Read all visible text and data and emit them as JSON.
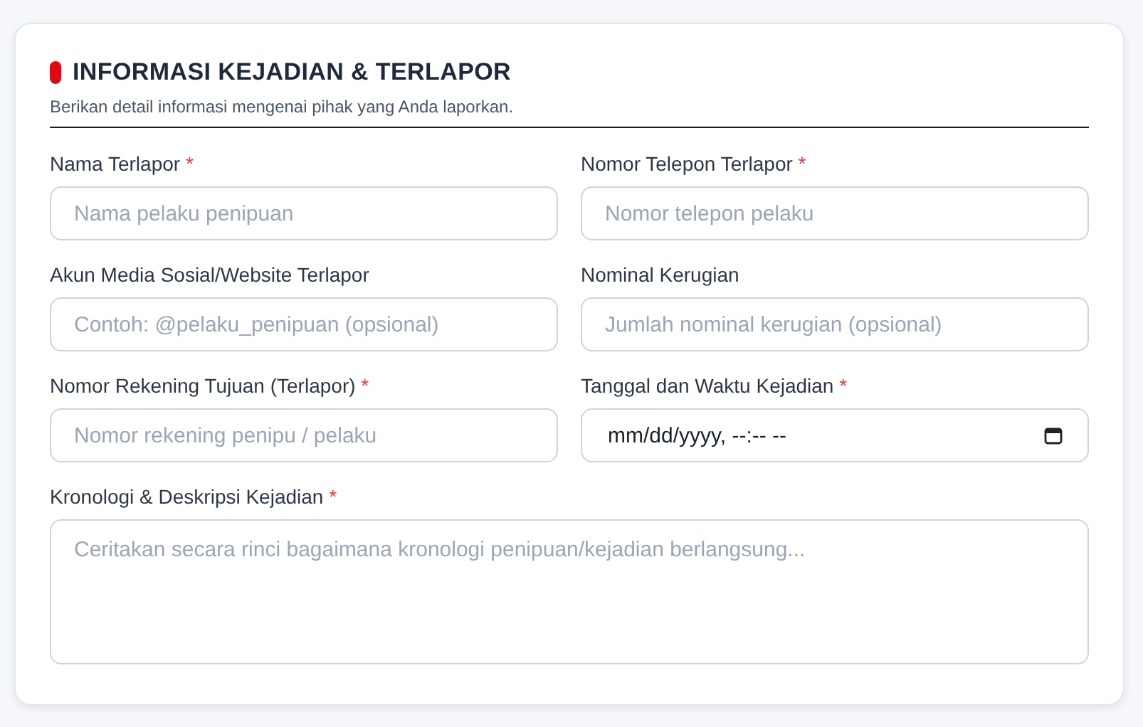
{
  "section": {
    "title": "INFORMASI KEJADIAN & TERLAPOR",
    "subtitle": "Berikan detail informasi mengenai pihak yang Anda laporkan."
  },
  "fields": [
    {
      "kind": "text",
      "label": "Nama Terlapor",
      "required_mark": "*",
      "placeholder": "Nama pelaku penipuan"
    },
    {
      "kind": "text",
      "label": "Nomor Telepon Terlapor",
      "required_mark": "*",
      "placeholder": "Nomor telepon pelaku"
    },
    {
      "kind": "text",
      "label": "Akun Media Sosial/Website Terlapor",
      "placeholder": "Contoh: @pelaku_penipuan (opsional)"
    },
    {
      "kind": "text",
      "label": "Nominal Kerugian",
      "placeholder": "Jumlah nominal kerugian (opsional)"
    },
    {
      "kind": "text",
      "label": "Nomor Rekening Tujuan (Terlapor)",
      "required_mark": "*",
      "placeholder": "Nomor rekening penipu / pelaku"
    },
    {
      "kind": "datetime",
      "label": "Tanggal dan Waktu Kejadian",
      "required_mark": "*",
      "placeholder": "mm/dd/yyyy, --:-- --"
    },
    {
      "kind": "textarea",
      "label": "Kronologi & Deskripsi Kejadian",
      "required_mark": "*",
      "placeholder": "Ceritakan secara rinci bagaimana kronologi penipuan/kejadian berlangsung..."
    }
  ]
}
